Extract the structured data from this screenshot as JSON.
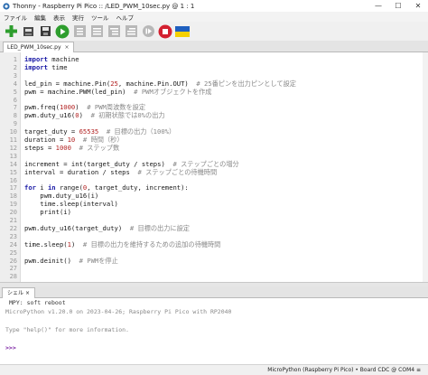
{
  "window": {
    "title": "Thonny - Raspberry Pi Pico :: /LED_PWM_10sec.py @ 1 : 1",
    "minimize": "—",
    "maximize": "☐",
    "close": "✕"
  },
  "menu": [
    "ファイル",
    "編集",
    "表示",
    "実行",
    "ツール",
    "ヘルプ"
  ],
  "toolbar": {
    "buttons": [
      "new-file",
      "open-file",
      "save-file",
      "run",
      "debug",
      "step-over",
      "step-into",
      "step-out",
      "resume",
      "stop",
      "support-ukraine"
    ],
    "colors": {
      "new": "#2e9e2e",
      "run": "#2e9e2e",
      "stop": "#d32030",
      "disabled": "#b8b8b8",
      "flag_top": "#1f5fbf",
      "flag_bottom": "#f5d000"
    }
  },
  "editor": {
    "tab_label": "LED_PWM_10sec.py",
    "tab_close": "×",
    "line_numbers": [
      "1",
      "2",
      "3",
      "4",
      "5",
      "6",
      "7",
      "8",
      "9",
      "10",
      "11",
      "12",
      "13",
      "14",
      "15",
      "16",
      "17",
      "18",
      "19",
      "20",
      "21",
      "22",
      "23",
      "24",
      "25",
      "26",
      "27",
      "28"
    ],
    "lines": [
      [
        {
          "t": "import",
          "c": "kw"
        },
        {
          "t": " machine",
          "c": ""
        }
      ],
      [
        {
          "t": "import",
          "c": "kw"
        },
        {
          "t": " time",
          "c": ""
        }
      ],
      [],
      [
        {
          "t": "led_pin = machine.Pin(",
          "c": ""
        },
        {
          "t": "25",
          "c": "num"
        },
        {
          "t": ", machine.Pin.OUT)  ",
          "c": ""
        },
        {
          "t": "# 25番ピンを出力ピンとして設定",
          "c": "cm"
        }
      ],
      [
        {
          "t": "pwm = machine.PWM(led_pin)  ",
          "c": ""
        },
        {
          "t": "# PWMオブジェクトを作成",
          "c": "cm"
        }
      ],
      [],
      [
        {
          "t": "pwm.freq(",
          "c": ""
        },
        {
          "t": "1000",
          "c": "num"
        },
        {
          "t": ")  ",
          "c": ""
        },
        {
          "t": "# PWM周波数を設定",
          "c": "cm"
        }
      ],
      [
        {
          "t": "pwm.duty_u16(",
          "c": ""
        },
        {
          "t": "0",
          "c": "num"
        },
        {
          "t": ")  ",
          "c": ""
        },
        {
          "t": "# 初期状態では0%の出力",
          "c": "cm"
        }
      ],
      [],
      [
        {
          "t": "target_duty = ",
          "c": ""
        },
        {
          "t": "65535",
          "c": "num"
        },
        {
          "t": "  ",
          "c": ""
        },
        {
          "t": "# 目標の出力（100%）",
          "c": "cm"
        }
      ],
      [
        {
          "t": "duration = ",
          "c": ""
        },
        {
          "t": "10",
          "c": "num"
        },
        {
          "t": "  ",
          "c": ""
        },
        {
          "t": "# 時間（秒）",
          "c": "cm"
        }
      ],
      [
        {
          "t": "steps = ",
          "c": ""
        },
        {
          "t": "1000",
          "c": "num"
        },
        {
          "t": "  ",
          "c": ""
        },
        {
          "t": "# ステップ数",
          "c": "cm"
        }
      ],
      [],
      [
        {
          "t": "increment = int(target_duty / steps)  ",
          "c": ""
        },
        {
          "t": "# ステップごとの増分",
          "c": "cm"
        }
      ],
      [
        {
          "t": "interval = duration / steps  ",
          "c": ""
        },
        {
          "t": "# ステップごとの待機時間",
          "c": "cm"
        }
      ],
      [],
      [
        {
          "t": "for",
          "c": "kw"
        },
        {
          "t": " i ",
          "c": ""
        },
        {
          "t": "in",
          "c": "kw"
        },
        {
          "t": " range(",
          "c": ""
        },
        {
          "t": "0",
          "c": "num"
        },
        {
          "t": ", target_duty, increment):",
          "c": ""
        }
      ],
      [
        {
          "t": "    pwm.duty_u16(i)",
          "c": ""
        }
      ],
      [
        {
          "t": "    time.sleep(interval)",
          "c": ""
        }
      ],
      [
        {
          "t": "    print(i)",
          "c": ""
        }
      ],
      [],
      [
        {
          "t": "pwm.duty_u16(target_duty)  ",
          "c": ""
        },
        {
          "t": "# 目標の出力に設定",
          "c": "cm"
        }
      ],
      [],
      [
        {
          "t": "time.sleep(",
          "c": ""
        },
        {
          "t": "1",
          "c": "num"
        },
        {
          "t": ")  ",
          "c": ""
        },
        {
          "t": "# 目標の出力を維持するための追加の待機時間",
          "c": "cm"
        }
      ],
      [],
      [
        {
          "t": "pwm.deinit()  ",
          "c": ""
        },
        {
          "t": "# PWMを停止",
          "c": "cm"
        }
      ],
      [],
      []
    ]
  },
  "shell": {
    "tab_label": "シェル",
    "tab_close": "×",
    "lines": [
      {
        "text": "MPY: soft reboot",
        "cls": "s-mpy"
      },
      {
        "text": "MicroPython v1.20.0 on 2023-04-26; Raspberry Pi Pico with RP2040",
        "cls": "s-muted"
      },
      {
        "text": "",
        "cls": ""
      },
      {
        "text": "Type \"help()\" for more information.",
        "cls": "s-muted"
      },
      {
        "text": "",
        "cls": ""
      },
      {
        "text": ">>>",
        "cls": "s-prompt"
      }
    ]
  },
  "status": {
    "interpreter": "MicroPython (Raspberry Pi Pico)  •  Board CDC @ COM4  ≡"
  }
}
